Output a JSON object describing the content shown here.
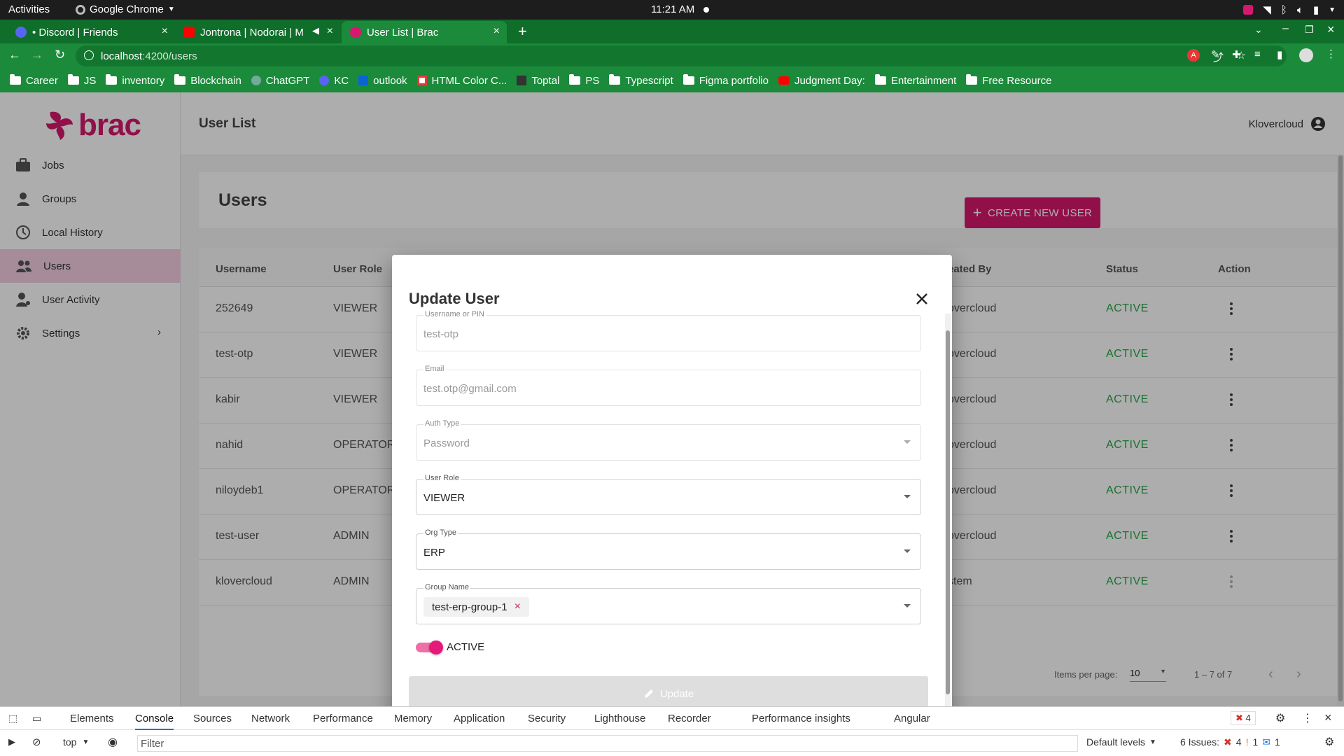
{
  "system_bar": {
    "activities": "Activities",
    "app_name": "Google Chrome",
    "clock": "11:21 AM"
  },
  "tabs": [
    {
      "label": "• Discord | Friends"
    },
    {
      "label": "Jontrona | Nodorai | M"
    },
    {
      "label": "User List | Brac"
    }
  ],
  "address_bar": {
    "host": "localhost",
    "path": ":4200/users"
  },
  "bookmarks": [
    {
      "label": "Career",
      "icon": "folder-icon"
    },
    {
      "label": "JS",
      "icon": "folder-icon"
    },
    {
      "label": "inventory",
      "icon": "folder-icon"
    },
    {
      "label": "Blockchain",
      "icon": "folder-icon"
    },
    {
      "label": "ChatGPT",
      "icon": "chatgpt-icon"
    },
    {
      "label": "KC",
      "icon": "kc-icon"
    },
    {
      "label": "outlook",
      "icon": "outlook-icon"
    },
    {
      "label": "HTML Color C...",
      "icon": "html-color-icon"
    },
    {
      "label": "Toptal",
      "icon": "js-icon"
    },
    {
      "label": "PS",
      "icon": "folder-icon"
    },
    {
      "label": "Typescript",
      "icon": "folder-icon"
    },
    {
      "label": "Figma portfolio",
      "icon": "folder-icon"
    },
    {
      "label": "Judgment Day:",
      "icon": "youtube-icon"
    },
    {
      "label": "Entertainment",
      "icon": "folder-icon"
    },
    {
      "label": "Free Resource",
      "icon": "folder-icon"
    }
  ],
  "brand": {
    "name": "brac",
    "color": "#d6196e"
  },
  "sidebar": {
    "items": [
      {
        "label": "Jobs",
        "icon": "briefcase-icon"
      },
      {
        "label": "Groups",
        "icon": "groups-icon"
      },
      {
        "label": "Local History",
        "icon": "history-icon"
      },
      {
        "label": "Users",
        "icon": "users-icon",
        "active": true
      },
      {
        "label": "User Activity",
        "icon": "user-activity-icon"
      },
      {
        "label": "Settings",
        "icon": "gear-icon"
      }
    ]
  },
  "header": {
    "page_title": "User List",
    "user_name": "Klovercloud"
  },
  "users_card": {
    "title": "Users",
    "create_button": "CREATE NEW USER"
  },
  "table": {
    "columns": [
      "Username",
      "User Role",
      "eated By",
      "Status",
      "Action"
    ],
    "rows": [
      {
        "username": "252649",
        "role": "VIEWER",
        "created_by": "overcloud",
        "status": "ACTIVE"
      },
      {
        "username": "test-otp",
        "role": "VIEWER",
        "created_by": "overcloud",
        "status": "ACTIVE"
      },
      {
        "username": "kabir",
        "role": "VIEWER",
        "created_by": "overcloud",
        "status": "ACTIVE"
      },
      {
        "username": "nahid",
        "role": "OPERATOR",
        "created_by": "overcloud",
        "status": "ACTIVE"
      },
      {
        "username": "niloydeb1",
        "role": "OPERATOR",
        "created_by": "overcloud",
        "status": "ACTIVE"
      },
      {
        "username": "test-user",
        "role": "ADMIN",
        "created_by": "overcloud",
        "status": "ACTIVE"
      },
      {
        "username": "klovercloud",
        "role": "ADMIN",
        "created_by": "stem",
        "status": "ACTIVE"
      }
    ],
    "pager": {
      "items_per_page_label": "Items per page:",
      "items_per_page": "10",
      "range": "1 – 7 of 7"
    }
  },
  "modal": {
    "title": "Update User",
    "fields": {
      "username": {
        "label": "Username or PIN",
        "value": "test-otp"
      },
      "email": {
        "label": "Email",
        "value": "test.otp@gmail.com"
      },
      "auth_type": {
        "label": "Auth Type",
        "value": "Password"
      },
      "user_role": {
        "label": "User Role",
        "value": "VIEWER"
      },
      "org_type": {
        "label": "Org Type",
        "value": "ERP"
      },
      "group_name": {
        "label": "Group Name",
        "chip": "test-erp-group-1"
      }
    },
    "active_toggle": {
      "label": "ACTIVE",
      "on": true
    },
    "update_button": "Update"
  },
  "devtools": {
    "tabs": [
      "Elements",
      "Console",
      "Sources",
      "Network",
      "Performance",
      "Memory",
      "Application",
      "Security",
      "Lighthouse",
      "Recorder",
      "Performance insights",
      "Angular"
    ],
    "error_count": "4",
    "context": "top",
    "filter_placeholder": "Filter",
    "levels": "Default levels",
    "issues_label": "6 Issues:",
    "issues": {
      "errors": "4",
      "warnings": "1",
      "info": "1"
    }
  }
}
